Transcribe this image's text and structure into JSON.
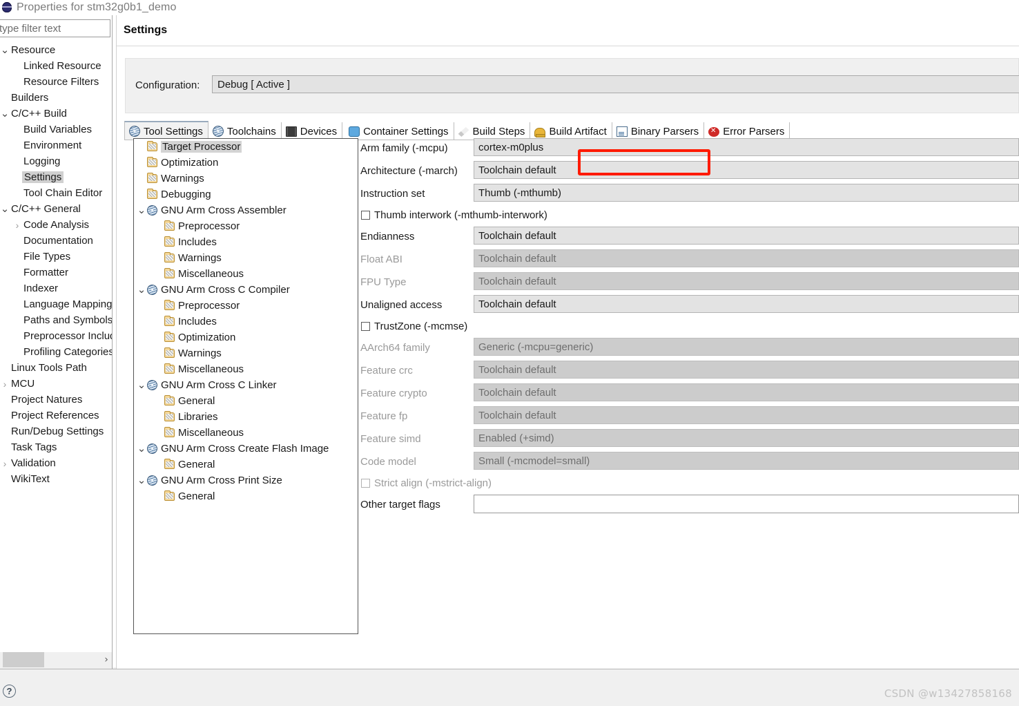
{
  "window": {
    "title": "Properties for stm32g0b1_demo",
    "icon": "eclipse-globe-icon"
  },
  "sidebar": {
    "filter": {
      "value": "",
      "placeholder": "type filter text"
    },
    "items": [
      {
        "label": "Resource",
        "indent": 0,
        "twisty": "expanded",
        "selected": false
      },
      {
        "label": "Linked Resource",
        "indent": 1,
        "twisty": "none",
        "selected": false
      },
      {
        "label": "Resource Filters",
        "indent": 1,
        "twisty": "none",
        "selected": false
      },
      {
        "label": "Builders",
        "indent": 0,
        "twisty": "none",
        "selected": false
      },
      {
        "label": "C/C++ Build",
        "indent": 0,
        "twisty": "expanded",
        "selected": false
      },
      {
        "label": "Build Variables",
        "indent": 1,
        "twisty": "none",
        "selected": false
      },
      {
        "label": "Environment",
        "indent": 1,
        "twisty": "none",
        "selected": false
      },
      {
        "label": "Logging",
        "indent": 1,
        "twisty": "none",
        "selected": false
      },
      {
        "label": "Settings",
        "indent": 1,
        "twisty": "none",
        "selected": true
      },
      {
        "label": "Tool Chain Editor",
        "indent": 1,
        "twisty": "none",
        "selected": false
      },
      {
        "label": "C/C++ General",
        "indent": 0,
        "twisty": "expanded",
        "selected": false
      },
      {
        "label": "Code Analysis",
        "indent": 1,
        "twisty": "collapsed",
        "selected": false
      },
      {
        "label": "Documentation",
        "indent": 1,
        "twisty": "none",
        "selected": false
      },
      {
        "label": "File Types",
        "indent": 1,
        "twisty": "none",
        "selected": false
      },
      {
        "label": "Formatter",
        "indent": 1,
        "twisty": "none",
        "selected": false
      },
      {
        "label": "Indexer",
        "indent": 1,
        "twisty": "none",
        "selected": false
      },
      {
        "label": "Language Mappings",
        "indent": 1,
        "twisty": "none",
        "selected": false
      },
      {
        "label": "Paths and Symbols",
        "indent": 1,
        "twisty": "none",
        "selected": false
      },
      {
        "label": "Preprocessor Include",
        "indent": 1,
        "twisty": "none",
        "selected": false
      },
      {
        "label": "Profiling Categories",
        "indent": 1,
        "twisty": "none",
        "selected": false
      },
      {
        "label": "Linux Tools Path",
        "indent": 0,
        "twisty": "none",
        "selected": false
      },
      {
        "label": "MCU",
        "indent": 0,
        "twisty": "collapsed",
        "selected": false
      },
      {
        "label": "Project Natures",
        "indent": 0,
        "twisty": "none",
        "selected": false
      },
      {
        "label": "Project References",
        "indent": 0,
        "twisty": "none",
        "selected": false
      },
      {
        "label": "Run/Debug Settings",
        "indent": 0,
        "twisty": "none",
        "selected": false
      },
      {
        "label": "Task Tags",
        "indent": 0,
        "twisty": "none",
        "selected": false
      },
      {
        "label": "Validation",
        "indent": 0,
        "twisty": "collapsed",
        "selected": false
      },
      {
        "label": "WikiText",
        "indent": 0,
        "twisty": "none",
        "selected": false
      }
    ]
  },
  "page": {
    "title": "Settings",
    "configuration_label": "Configuration:",
    "configuration_value": "Debug  [ Active ]"
  },
  "tabs": [
    {
      "label": "Tool Settings",
      "icon": "tool-globe-icon",
      "active": true
    },
    {
      "label": "Toolchains",
      "icon": "tool-globe-icon",
      "active": false
    },
    {
      "label": "Devices",
      "icon": "device-chip-icon",
      "active": false
    },
    {
      "label": "Container Settings",
      "icon": "container-icon",
      "active": false
    },
    {
      "label": "Build Steps",
      "icon": "build-steps-icon",
      "active": false
    },
    {
      "label": "Build Artifact",
      "icon": "build-artifact-icon",
      "active": false
    },
    {
      "label": "Binary Parsers",
      "icon": "binary-parser-icon",
      "active": false
    },
    {
      "label": "Error Parsers",
      "icon": "error-parser-icon",
      "active": false
    }
  ],
  "tooltree": [
    {
      "label": "Target Processor",
      "indent": 0,
      "twisty": "none",
      "icon": "folder-icon",
      "selected": true
    },
    {
      "label": "Optimization",
      "indent": 0,
      "twisty": "none",
      "icon": "folder-icon",
      "selected": false
    },
    {
      "label": "Warnings",
      "indent": 0,
      "twisty": "none",
      "icon": "folder-icon",
      "selected": false
    },
    {
      "label": "Debugging",
      "indent": 0,
      "twisty": "none",
      "icon": "folder-icon",
      "selected": false
    },
    {
      "label": "GNU Arm Cross Assembler",
      "indent": 0,
      "twisty": "expanded",
      "icon": "tool-globe-icon",
      "selected": false
    },
    {
      "label": "Preprocessor",
      "indent": 1,
      "twisty": "none",
      "icon": "folder-icon",
      "selected": false
    },
    {
      "label": "Includes",
      "indent": 1,
      "twisty": "none",
      "icon": "folder-icon",
      "selected": false
    },
    {
      "label": "Warnings",
      "indent": 1,
      "twisty": "none",
      "icon": "folder-icon",
      "selected": false
    },
    {
      "label": "Miscellaneous",
      "indent": 1,
      "twisty": "none",
      "icon": "folder-icon",
      "selected": false
    },
    {
      "label": "GNU Arm Cross C Compiler",
      "indent": 0,
      "twisty": "expanded",
      "icon": "tool-globe-icon",
      "selected": false
    },
    {
      "label": "Preprocessor",
      "indent": 1,
      "twisty": "none",
      "icon": "folder-icon",
      "selected": false
    },
    {
      "label": "Includes",
      "indent": 1,
      "twisty": "none",
      "icon": "folder-icon",
      "selected": false
    },
    {
      "label": "Optimization",
      "indent": 1,
      "twisty": "none",
      "icon": "folder-icon",
      "selected": false
    },
    {
      "label": "Warnings",
      "indent": 1,
      "twisty": "none",
      "icon": "folder-icon",
      "selected": false
    },
    {
      "label": "Miscellaneous",
      "indent": 1,
      "twisty": "none",
      "icon": "folder-icon",
      "selected": false
    },
    {
      "label": "GNU Arm Cross C Linker",
      "indent": 0,
      "twisty": "expanded",
      "icon": "tool-globe-icon",
      "selected": false
    },
    {
      "label": "General",
      "indent": 1,
      "twisty": "none",
      "icon": "folder-icon",
      "selected": false
    },
    {
      "label": "Libraries",
      "indent": 1,
      "twisty": "none",
      "icon": "folder-icon",
      "selected": false
    },
    {
      "label": "Miscellaneous",
      "indent": 1,
      "twisty": "none",
      "icon": "folder-icon",
      "selected": false
    },
    {
      "label": "GNU Arm Cross Create Flash Image",
      "indent": 0,
      "twisty": "expanded",
      "icon": "tool-globe-icon",
      "selected": false
    },
    {
      "label": "General",
      "indent": 1,
      "twisty": "none",
      "icon": "folder-icon",
      "selected": false
    },
    {
      "label": "GNU Arm Cross Print Size",
      "indent": 0,
      "twisty": "expanded",
      "icon": "tool-globe-icon",
      "selected": false
    },
    {
      "label": "General",
      "indent": 1,
      "twisty": "none",
      "icon": "folder-icon",
      "selected": false
    }
  ],
  "settings_form": {
    "rows": [
      {
        "kind": "combo",
        "label": "Arm family (-mcpu)",
        "value": "cortex-m0plus",
        "disabled": false,
        "highlighted": true
      },
      {
        "kind": "combo",
        "label": "Architecture (-march)",
        "value": "Toolchain default",
        "disabled": false,
        "highlighted": false
      },
      {
        "kind": "combo",
        "label": "Instruction set",
        "value": "Thumb (-mthumb)",
        "disabled": false,
        "highlighted": false
      },
      {
        "kind": "checkbox",
        "label": "Thumb interwork (-mthumb-interwork)",
        "checked": false,
        "disabled": false,
        "highlighted": false
      },
      {
        "kind": "combo",
        "label": "Endianness",
        "value": "Toolchain default",
        "disabled": false,
        "highlighted": false
      },
      {
        "kind": "combo",
        "label": "Float ABI",
        "value": "Toolchain default",
        "disabled": true,
        "highlighted": false
      },
      {
        "kind": "combo",
        "label": "FPU Type",
        "value": "Toolchain default",
        "disabled": true,
        "highlighted": false
      },
      {
        "kind": "combo",
        "label": "Unaligned access",
        "value": "Toolchain default",
        "disabled": false,
        "highlighted": false
      },
      {
        "kind": "checkbox",
        "label": "TrustZone (-mcmse)",
        "checked": false,
        "disabled": false,
        "highlighted": false
      },
      {
        "kind": "combo",
        "label": "AArch64 family",
        "value": "Generic (-mcpu=generic)",
        "disabled": true,
        "highlighted": false
      },
      {
        "kind": "combo",
        "label": "Feature crc",
        "value": "Toolchain default",
        "disabled": true,
        "highlighted": false
      },
      {
        "kind": "combo",
        "label": "Feature crypto",
        "value": "Toolchain default",
        "disabled": true,
        "highlighted": false
      },
      {
        "kind": "combo",
        "label": "Feature fp",
        "value": "Toolchain default",
        "disabled": true,
        "highlighted": false
      },
      {
        "kind": "combo",
        "label": "Feature simd",
        "value": "Enabled (+simd)",
        "disabled": true,
        "highlighted": false
      },
      {
        "kind": "combo",
        "label": "Code model",
        "value": "Small (-mcmodel=small)",
        "disabled": true,
        "highlighted": false
      },
      {
        "kind": "checkbox",
        "label": "Strict align (-mstrict-align)",
        "checked": false,
        "disabled": true,
        "highlighted": false
      },
      {
        "kind": "text",
        "label": "Other target flags",
        "value": "",
        "disabled": false,
        "highlighted": false
      }
    ]
  },
  "footer": {
    "help_label": "?",
    "watermark": "CSDN @w13427858168"
  },
  "colors": {
    "highlight_box": "#ff1a00",
    "selection": "#d0d0d0",
    "combo_bg": "#e3e3e3",
    "combo_bg_disabled": "#cccccc",
    "panel_bg": "#f0f0f0"
  }
}
